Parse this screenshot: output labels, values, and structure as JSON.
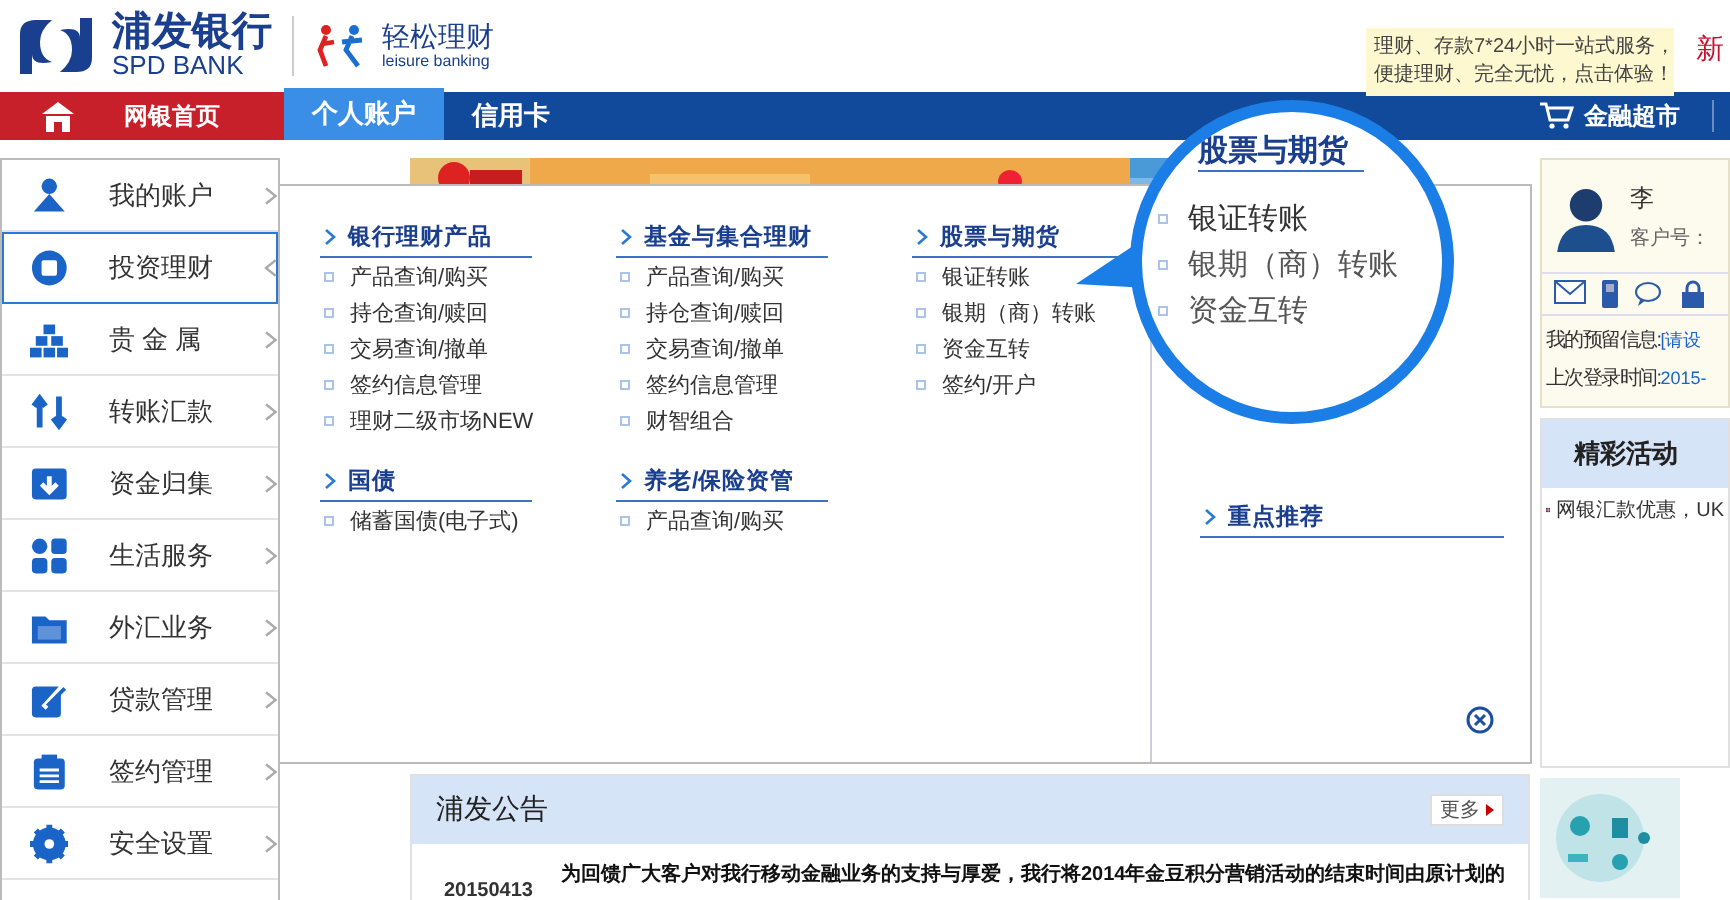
{
  "header": {
    "bank_name": "浦发银行",
    "bank_name_en": "SPD BANK",
    "product_name": "轻松理财",
    "product_name_en": "leisure banking",
    "tooltip_lines": [
      "理财、存款7*24小时一站式服务，",
      "便捷理财、完全无忧，点击体验！"
    ],
    "new_mark": "新"
  },
  "nav": {
    "home": "网银首页",
    "tabs": [
      {
        "label": "个人账户",
        "selected": true
      },
      {
        "label": "信用卡",
        "selected": false
      }
    ],
    "market": "金融超市"
  },
  "sidebar": {
    "items": [
      {
        "label": "我的账户",
        "selected": false
      },
      {
        "label": "投资理财",
        "selected": true
      },
      {
        "label": "贵 金 属",
        "selected": false
      },
      {
        "label": "转账汇款",
        "selected": false
      },
      {
        "label": "资金归集",
        "selected": false
      },
      {
        "label": "生活服务",
        "selected": false
      },
      {
        "label": "外汇业务",
        "selected": false
      },
      {
        "label": "贷款管理",
        "selected": false
      },
      {
        "label": "签约管理",
        "selected": false
      },
      {
        "label": "安全设置",
        "selected": false
      }
    ]
  },
  "mega_menu": {
    "groups": [
      {
        "title": "银行理财产品",
        "items": [
          "产品查询/购买",
          "持仓查询/赎回",
          "交易查询/撤单",
          "签约信息管理",
          "理财二级市场NEW"
        ]
      },
      {
        "title": "基金与集合理财",
        "items": [
          "产品查询/购买",
          "持仓查询/赎回",
          "交易查询/撤单",
          "签约信息管理",
          "财智组合"
        ]
      },
      {
        "title": "股票与期货",
        "items": [
          "银证转账",
          "银期（商）转账",
          "资金互转",
          "签约/开户"
        ]
      },
      {
        "title": "国债",
        "items": [
          "储蓄国债(电子式)"
        ]
      },
      {
        "title": "养老/保险资管",
        "items": [
          "产品查询/购买"
        ]
      }
    ],
    "featured_title": "重点推荐"
  },
  "magnifier": {
    "title": "股票与期货",
    "items": [
      "银证转账",
      "银期（商）转账",
      "资金互转"
    ]
  },
  "user_panel": {
    "name": "李",
    "customer_no_label": "客户号：",
    "reserved_label": "我的预留信息:",
    "reserved_value": "[请设",
    "last_login_label": "上次登录时间:",
    "last_login_value": "2015-"
  },
  "activities": {
    "title": "精彩活动",
    "items": [
      "网银汇款优惠，UK"
    ]
  },
  "notice": {
    "title": "浦发公告",
    "more": "更多",
    "rows": [
      {
        "date": "20150413",
        "text": "为回馈广大客户对我行移动金融业务的支持与厚爱，我行将2014年金豆积分营销活动的结束时间由原计划的"
      }
    ]
  }
}
